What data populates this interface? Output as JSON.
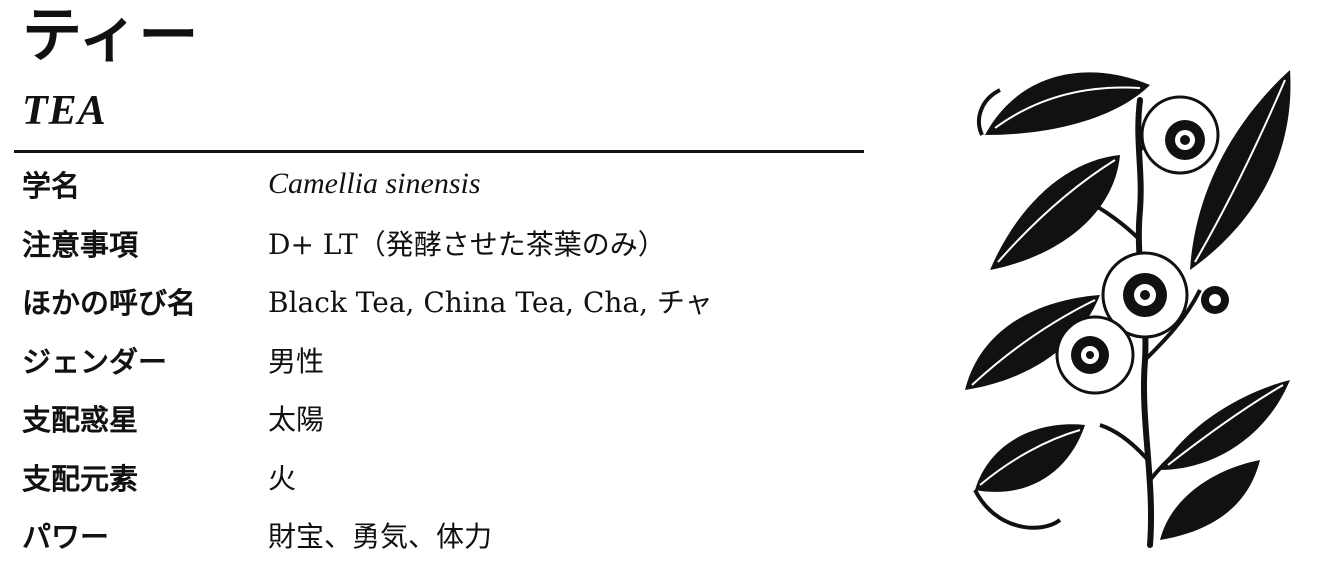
{
  "header": {
    "title_jp": "ティー",
    "title_en": "TEA"
  },
  "rows": [
    {
      "label": "学名",
      "value": "Camellia sinensis"
    },
    {
      "label": "注意事項",
      "value": "D+ LT（発酵させた茶葉のみ）"
    },
    {
      "label": "ほかの呼び名",
      "value": "Black Tea, China Tea, Cha,  チャ"
    },
    {
      "label": "ジェンダー",
      "value": "男性"
    },
    {
      "label": "支配惑星",
      "value": "太陽"
    },
    {
      "label": "支配元素",
      "value": "火"
    },
    {
      "label": "パワー",
      "value": "財宝、勇気、体力"
    }
  ],
  "illustration": {
    "subject": "tea plant (Camellia sinensis) botanical ink drawing"
  }
}
